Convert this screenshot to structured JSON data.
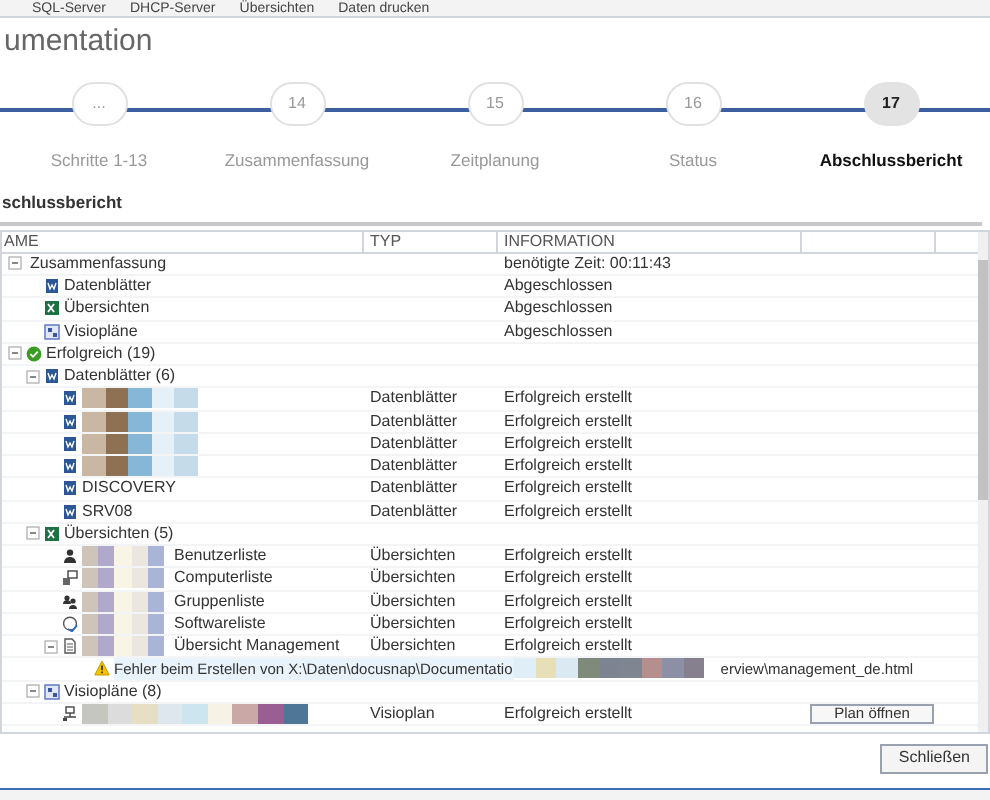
{
  "app_toolbar": [
    "SQL-Server",
    "DHCP-Server",
    "Übersichten",
    "Daten drucken"
  ],
  "window": {
    "title": "umentation"
  },
  "steps": [
    {
      "number": "...",
      "label": "Schritte 1-13",
      "selected": false
    },
    {
      "number": "14",
      "label": "Zusammenfassung",
      "selected": false
    },
    {
      "number": "15",
      "label": "Zeitplanung",
      "selected": false
    },
    {
      "number": "16",
      "label": "Status",
      "selected": false
    },
    {
      "number": "17",
      "label": "Abschlussbericht",
      "selected": true
    }
  ],
  "section_title": "schlussbericht",
  "table": {
    "columns": [
      "AME",
      "TYP",
      "INFORMATION"
    ],
    "rows": [
      {
        "kind": "group",
        "name": "Zusammenfassung",
        "expanded": true,
        "information": "benötigte Zeit: 00:11:43",
        "children": [
          {
            "kind": "datasheet",
            "name": "Datenblätter",
            "information": "Abgeschlossen"
          },
          {
            "kind": "overview",
            "name": "Übersichten",
            "information": "Abgeschlossen"
          },
          {
            "kind": "visio",
            "name": "Visiopläne",
            "information": "Abgeschlossen"
          }
        ]
      },
      {
        "kind": "success",
        "name": "Erfolgreich (19)",
        "expanded": true,
        "children": [
          {
            "kind": "datasheet",
            "name": "Datenblätter (6)",
            "expanded": true,
            "children": [
              {
                "kind": "datasheet",
                "blurred": true,
                "type": "Datenblätter",
                "information": "Erfolgreich erstellt"
              },
              {
                "kind": "datasheet",
                "blurred": true,
                "type": "Datenblätter",
                "information": "Erfolgreich erstellt"
              },
              {
                "kind": "datasheet",
                "blurred": true,
                "type": "Datenblätter",
                "information": "Erfolgreich erstellt"
              },
              {
                "kind": "datasheet",
                "blurred": true,
                "type": "Datenblätter",
                "information": "Erfolgreich erstellt"
              },
              {
                "kind": "datasheet",
                "name": "DISCOVERY",
                "type": "Datenblätter",
                "information": "Erfolgreich erstellt"
              },
              {
                "kind": "datasheet",
                "name": "SRV08",
                "type": "Datenblätter",
                "information": "Erfolgreich erstellt"
              }
            ]
          },
          {
            "kind": "overview",
            "name": "Übersichten (5)",
            "expanded": true,
            "children": [
              {
                "kind": "user",
                "blurred": true,
                "name": "Benutzerliste",
                "type": "Übersichten",
                "information": "Erfolgreich erstellt"
              },
              {
                "kind": "computer",
                "blurred": true,
                "name": "Computerliste",
                "type": "Übersichten",
                "information": "Erfolgreich erstellt"
              },
              {
                "kind": "users",
                "blurred": true,
                "name": "Gruppenliste",
                "type": "Übersichten",
                "information": "Erfolgreich erstellt"
              },
              {
                "kind": "software",
                "blurred": true,
                "name": "Softwareliste",
                "type": "Übersichten",
                "information": "Erfolgreich erstellt"
              },
              {
                "kind": "document",
                "blurred": true,
                "name": "Übersicht Management",
                "type": "Übersichten",
                "information": "Erfolgreich erstellt",
                "expanded": true,
                "children": [
                  {
                    "kind": "error",
                    "message": "Fehler beim Erstellen von X:\\Daten\\docusnap\\Documentatio",
                    "tail": "erview\\management_de.html"
                  }
                ]
              }
            ]
          },
          {
            "kind": "visio",
            "name": "Visiopläne (8)",
            "expanded": true,
            "children": [
              {
                "kind": "network",
                "blurred": true,
                "type": "Visioplan",
                "information": "Erfolgreich erstellt",
                "action": "Plan öffnen"
              }
            ]
          }
        ]
      }
    ]
  },
  "close_button": "Schließen"
}
